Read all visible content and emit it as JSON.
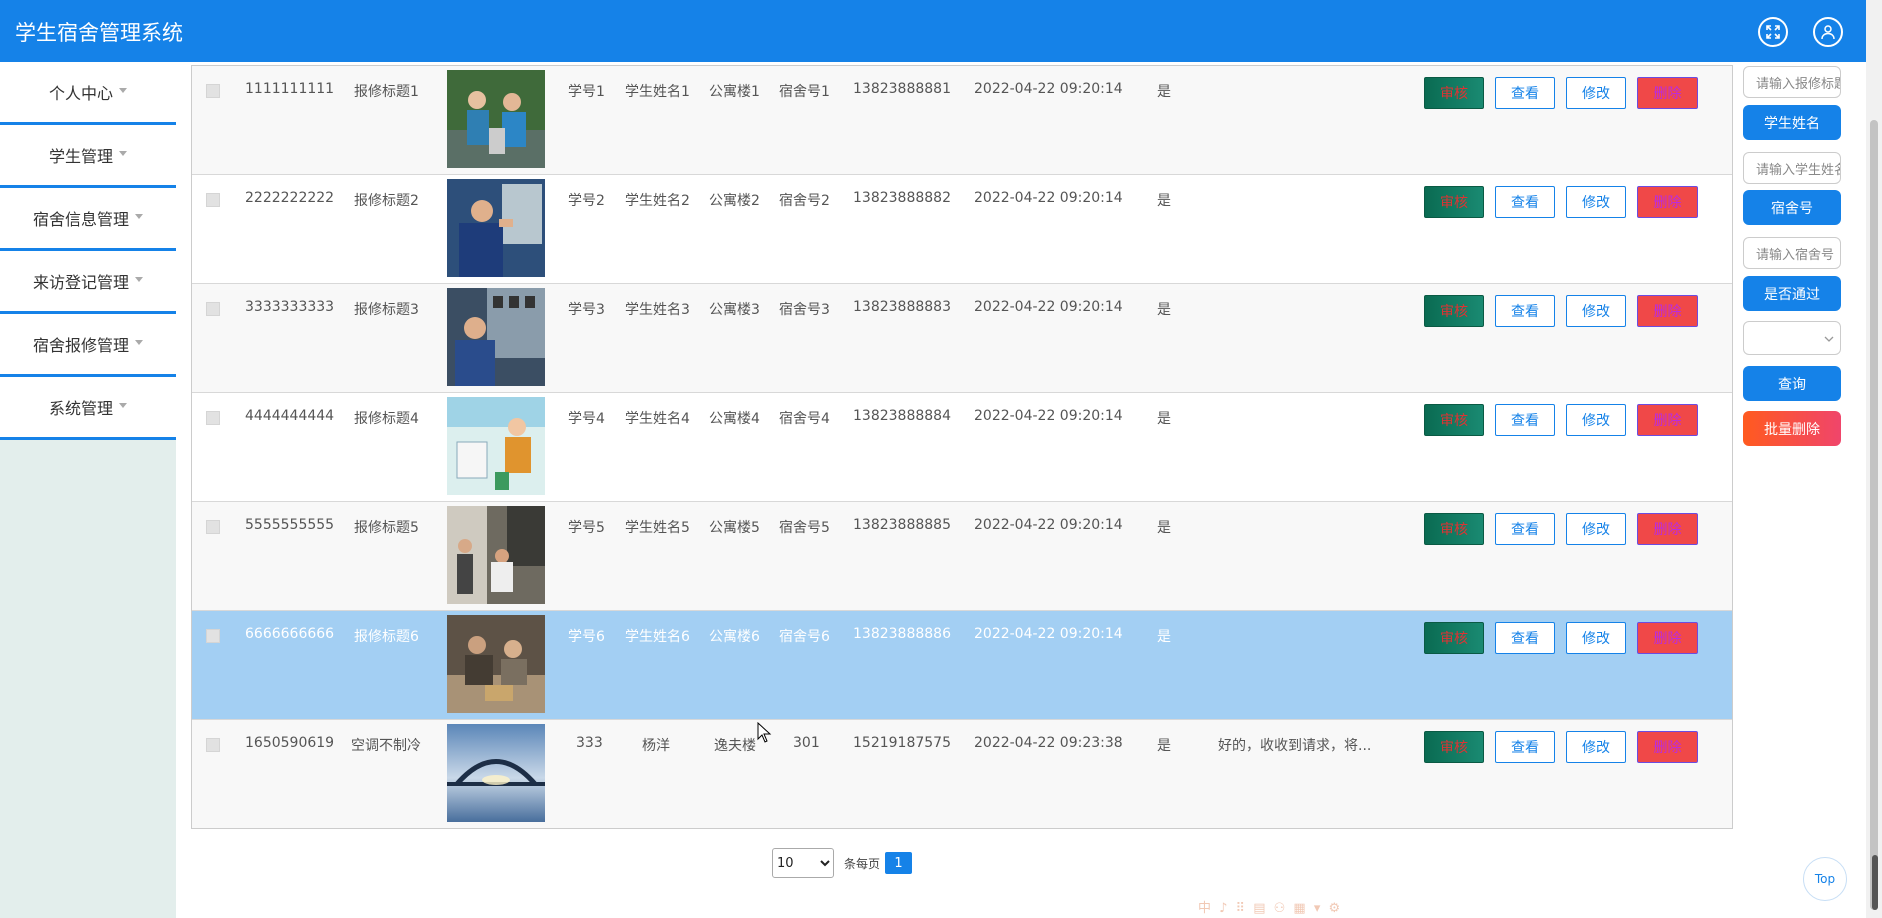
{
  "app": {
    "title": "学生宿舍管理系统"
  },
  "header": {
    "fullscreen_icon": "expand-icon",
    "user_icon": "user-icon"
  },
  "sidebar": {
    "items": [
      {
        "label": "个人中心"
      },
      {
        "label": "学生管理"
      },
      {
        "label": "宿舍信息管理"
      },
      {
        "label": "来访登记管理"
      },
      {
        "label": "宿舍报修管理"
      },
      {
        "label": "系统管理"
      }
    ]
  },
  "table": {
    "rows": [
      {
        "id": "1111111111",
        "title": "报修标题1",
        "student_no": "学号1",
        "student_name": "学生姓名1",
        "building": "公寓楼1",
        "room": "宿舍号1",
        "phone": "13823888881",
        "time": "2022-04-22 09:20:14",
        "approved": "是",
        "reply": ""
      },
      {
        "id": "2222222222",
        "title": "报修标题2",
        "student_no": "学号2",
        "student_name": "学生姓名2",
        "building": "公寓楼2",
        "room": "宿舍号2",
        "phone": "13823888882",
        "time": "2022-04-22 09:20:14",
        "approved": "是",
        "reply": ""
      },
      {
        "id": "3333333333",
        "title": "报修标题3",
        "student_no": "学号3",
        "student_name": "学生姓名3",
        "building": "公寓楼3",
        "room": "宿舍号3",
        "phone": "13823888883",
        "time": "2022-04-22 09:20:14",
        "approved": "是",
        "reply": ""
      },
      {
        "id": "4444444444",
        "title": "报修标题4",
        "student_no": "学号4",
        "student_name": "学生姓名4",
        "building": "公寓楼4",
        "room": "宿舍号4",
        "phone": "13823888884",
        "time": "2022-04-22 09:20:14",
        "approved": "是",
        "reply": ""
      },
      {
        "id": "5555555555",
        "title": "报修标题5",
        "student_no": "学号5",
        "student_name": "学生姓名5",
        "building": "公寓楼5",
        "room": "宿舍号5",
        "phone": "13823888885",
        "time": "2022-04-22 09:20:14",
        "approved": "是",
        "reply": ""
      },
      {
        "id": "6666666666",
        "title": "报修标题6",
        "student_no": "学号6",
        "student_name": "学生姓名6",
        "building": "公寓楼6",
        "room": "宿舍号6",
        "phone": "13823888886",
        "time": "2022-04-22 09:20:14",
        "approved": "是",
        "reply": ""
      },
      {
        "id": "1650590619",
        "title": "空调不制冷",
        "student_no": "333",
        "student_name": "杨洋",
        "building": "逸夫楼",
        "room": "301",
        "phone": "15219187575",
        "time": "2022-04-22 09:23:38",
        "approved": "是",
        "reply": "好的，收收到请求，将..."
      }
    ],
    "actions": {
      "audit": "审核",
      "view": "查看",
      "edit": "修改",
      "delete": "删除"
    }
  },
  "pagination": {
    "page_size": "10",
    "page_size_options": [
      "10"
    ],
    "per_page_label": "条每页",
    "current_page": "1"
  },
  "search_panel": {
    "title_placeholder": "请输入报修标题",
    "name_label": "学生姓名",
    "name_placeholder": "请输入学生姓名",
    "room_label": "宿舍号",
    "room_placeholder": "请输入宿舍号",
    "approved_label": "是否通过",
    "approved_value": "",
    "query_button": "查询",
    "batch_delete_button": "批量删除"
  },
  "top_button": {
    "label": "Top"
  },
  "ime_toolbar": {
    "text": "中 ♪ ⠿ ▤ ⚇ ▦ ▾ ⚙"
  }
}
